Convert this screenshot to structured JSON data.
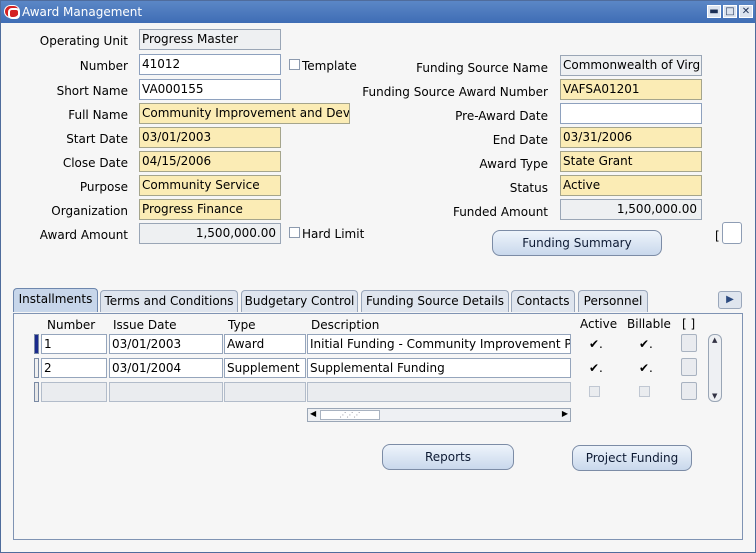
{
  "window": {
    "title": "Award Management",
    "minimize_glyph": "▬",
    "maximize_glyph": "□",
    "close_glyph": "✕"
  },
  "form": {
    "operating_unit": {
      "label": "Operating Unit",
      "value": "Progress Master"
    },
    "number": {
      "label": "Number",
      "value": "41012"
    },
    "template": {
      "label": "Template",
      "checked": false
    },
    "short_name": {
      "label": "Short Name",
      "value": "VA000155"
    },
    "full_name": {
      "label": "Full Name",
      "value": "Community Improvement and Develo"
    },
    "start_date": {
      "label": "Start Date",
      "value": "03/01/2003"
    },
    "close_date": {
      "label": "Close Date",
      "value": "04/15/2006"
    },
    "purpose": {
      "label": "Purpose",
      "value": "Community Service"
    },
    "organization": {
      "label": "Organization",
      "value": "Progress Finance"
    },
    "award_amount": {
      "label": "Award Amount",
      "value": "1,500,000.00"
    },
    "hard_limit": {
      "label": "Hard Limit",
      "checked": false
    },
    "funding_source_name": {
      "label": "Funding Source Name",
      "value": "Commonwealth of Virgin"
    },
    "funding_source_award_number": {
      "label": "Funding Source Award Number",
      "value": "VAFSA01201"
    },
    "pre_award_date": {
      "label": "Pre-Award Date",
      "value": ""
    },
    "end_date": {
      "label": "End Date",
      "value": "03/31/2006"
    },
    "award_type": {
      "label": "Award Type",
      "value": "State Grant"
    },
    "status": {
      "label": "Status",
      "value": "Active"
    },
    "funded_amount": {
      "label": "Funded Amount",
      "value": "1,500,000.00"
    },
    "funding_summary_label": "Funding Summary",
    "bracket_open": "[",
    "bracket_close": "]"
  },
  "tabs": [
    {
      "label": "Installments",
      "active": true
    },
    {
      "label": "Terms and Conditions",
      "active": false
    },
    {
      "label": "Budgetary Control",
      "active": false
    },
    {
      "label": "Funding Source Details",
      "active": false
    },
    {
      "label": "Contacts",
      "active": false
    },
    {
      "label": "Personnel",
      "active": false
    }
  ],
  "tab_scroll_glyph": "▶",
  "installments": {
    "headers": {
      "number": "Number",
      "issue_date": "Issue Date",
      "type": "Type",
      "description": "Description",
      "active": "Active",
      "billable": "Billable",
      "bracket": "[ ]"
    },
    "rows": [
      {
        "number": "1",
        "issue_date": "03/01/2003",
        "type": "Award",
        "description": "Initial Funding - Community Improvement Proj",
        "active": "✔.",
        "billable": "✔."
      },
      {
        "number": "2",
        "issue_date": "03/01/2004",
        "type": "Supplement",
        "description": "Supplemental Funding",
        "active": "✔.",
        "billable": "✔."
      },
      {
        "number": "",
        "issue_date": "",
        "type": "",
        "description": "",
        "active": "",
        "billable": ""
      }
    ],
    "scroll_left_glyph": "◀",
    "scroll_right_glyph": "▶",
    "scroll_grip_glyph": "⋰⋰⋰",
    "scroll_up_glyph": "▲",
    "scroll_down_glyph": "▼"
  },
  "buttons": {
    "reports": "Reports",
    "project_funding": "Project Funding"
  }
}
